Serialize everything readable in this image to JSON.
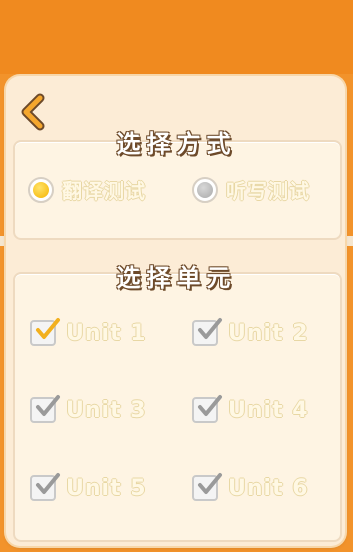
{
  "dialog": {
    "mode_title": "选择方式",
    "unit_title": "选择单元"
  },
  "modes": [
    {
      "label": "翻译测试",
      "selected": true
    },
    {
      "label": "听写测试",
      "selected": false
    }
  ],
  "units": [
    {
      "label": "Unit 1",
      "checked": true
    },
    {
      "label": "Unit 2",
      "checked": true
    },
    {
      "label": "Unit 3",
      "checked": true
    },
    {
      "label": "Unit 4",
      "checked": true
    },
    {
      "label": "Unit 5",
      "checked": true
    },
    {
      "label": "Unit 6",
      "checked": true
    }
  ],
  "colors": {
    "background": "#f2932b",
    "dialog": "#fcecd6",
    "radio_selected": "#f5b400",
    "check_first": "#f2b01e",
    "check_rest": "#9a9a9a"
  }
}
